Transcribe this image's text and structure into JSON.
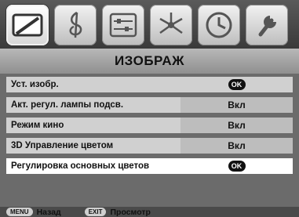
{
  "menu": {
    "title": "ИЗОБРАЖ",
    "tabs": [
      {
        "icon": "picture-icon",
        "active": true
      },
      {
        "icon": "music-clef-icon",
        "active": false
      },
      {
        "icon": "settings-sliders-icon",
        "active": false
      },
      {
        "icon": "network-icon",
        "active": false
      },
      {
        "icon": "clock-icon",
        "active": false
      },
      {
        "icon": "wrench-icon",
        "active": false
      }
    ],
    "rows": [
      {
        "label": "Уст. изобр.",
        "value": "OK"
      },
      {
        "label": "Акт. регул. лампы подсв.",
        "value": "Вкл"
      },
      {
        "label": "Режим кино",
        "value": "Вкл"
      },
      {
        "label": "3D Управление цветом",
        "value": "Вкл"
      },
      {
        "label": "Регулировка основных цветов",
        "value": "OK"
      }
    ]
  },
  "footer": {
    "menu_key": "MENU",
    "menu_label": "Назад",
    "exit_key": "EXIT",
    "exit_label": "Просмотр"
  },
  "colors": {
    "background": "#6b6b6b",
    "row": "#d0d0d0",
    "row_selected": "#ffffff",
    "ok_button": "#111111"
  }
}
